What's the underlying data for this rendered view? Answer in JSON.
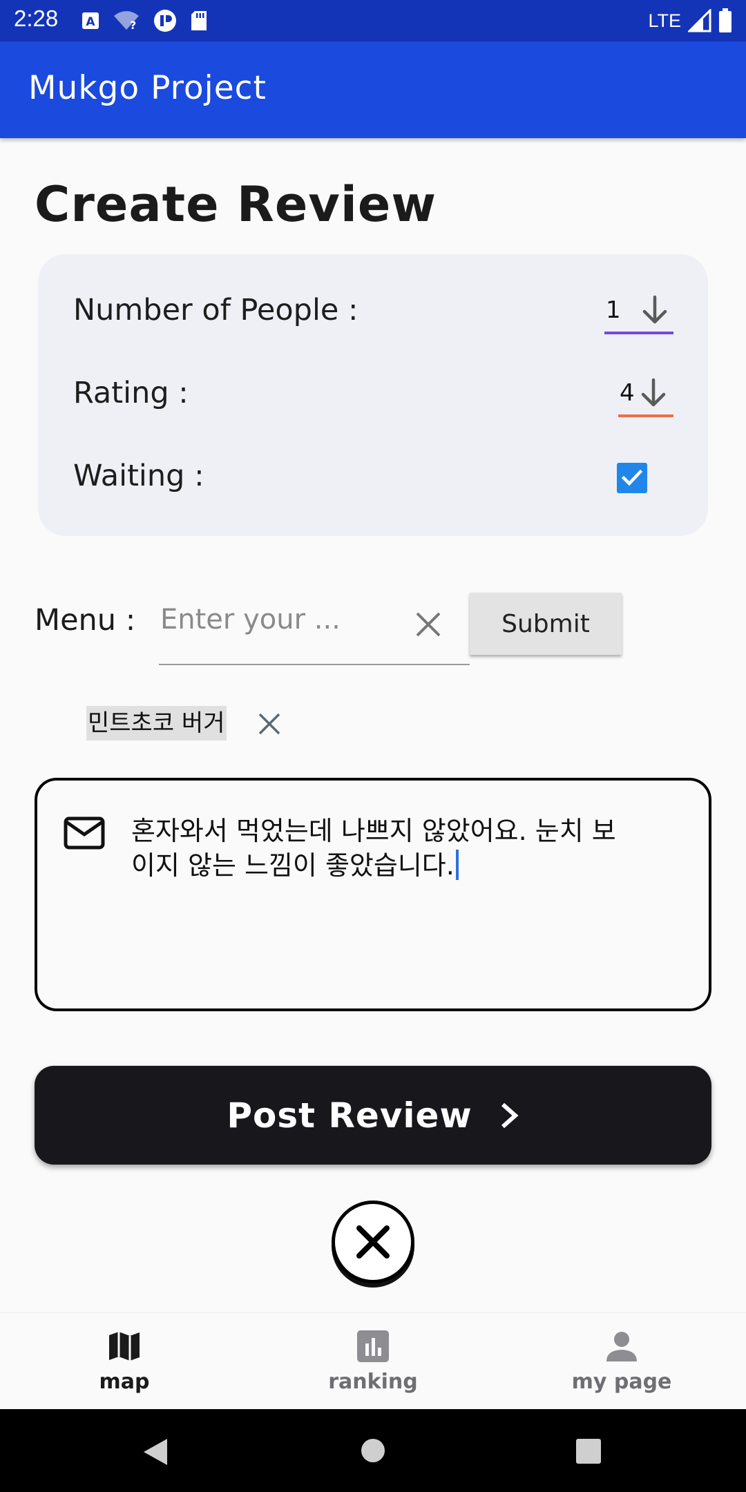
{
  "status_bar": {
    "time": "2:28",
    "network": "LTE"
  },
  "app_bar": {
    "title": "Mukgo Project"
  },
  "page": {
    "title": "Create Review"
  },
  "form": {
    "people_label": "Number of People :",
    "people_value": "1",
    "rating_label": "Rating :",
    "rating_value": "4",
    "waiting_label": "Waiting :",
    "waiting_checked": true,
    "colors": {
      "people_underline": "#7048e8",
      "rating_underline": "#ef6c4a",
      "checkbox": "#2186e9"
    }
  },
  "menu": {
    "label": "Menu :",
    "placeholder": "Enter your ...",
    "value": "",
    "submit_label": "Submit",
    "chips": [
      "민트초코 버거"
    ]
  },
  "review": {
    "text_line1": "혼자와서 먹었는데 나쁘지 않았어요. 눈치 보",
    "text_line2": "이지 않는 느낌이 좋았습니다."
  },
  "post_button": {
    "label": "Post Review"
  },
  "bottom_nav": {
    "items": [
      {
        "label": "map",
        "icon": "map-icon",
        "active": true
      },
      {
        "label": "ranking",
        "icon": "ranking-icon",
        "active": false
      },
      {
        "label": "my page",
        "icon": "person-icon",
        "active": false
      }
    ]
  }
}
